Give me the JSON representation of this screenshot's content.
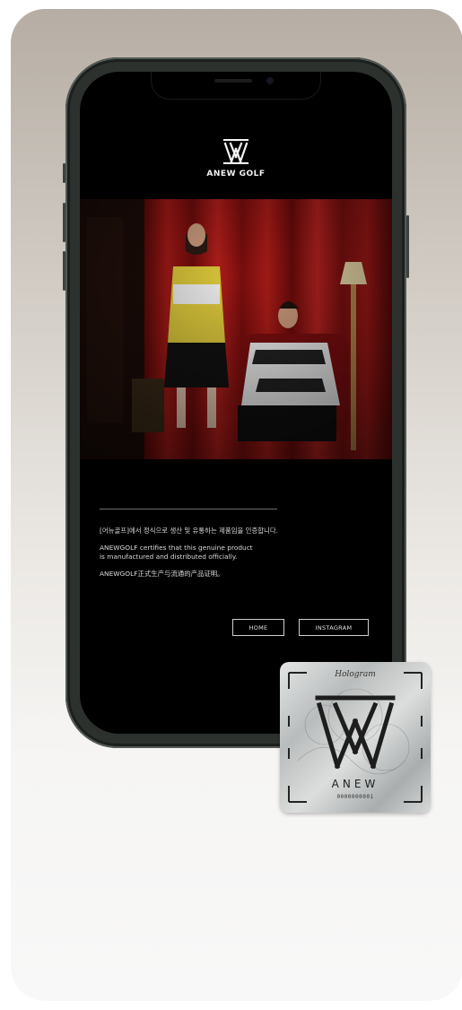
{
  "phone_screen": {
    "brand": {
      "logo": "anew-logo-icon",
      "name": "ANEW GOLF"
    },
    "hero_image": "anew-campaign-photo",
    "certificate": {
      "korean_line": "[어뉴골프]에서 정식으로 생산 및 유통하는 제품임을 인증합니다.",
      "english_line": "ANEWGOLF certifies that this genuine product\nis manufactured and distributed officially.",
      "chinese_line": "ANEWGOLF正式生产与流通的产品证明。"
    },
    "buttons": {
      "home": "HOME",
      "instagram": "INSTAGRAM"
    }
  },
  "hologram_sticker": {
    "top_text": "Hologram",
    "word": "ANEW",
    "serial": "0000000001"
  },
  "colors": {
    "screen_bg": "#000000",
    "phone_frame": "#2c312e",
    "curtain_red": "#8e1414"
  }
}
